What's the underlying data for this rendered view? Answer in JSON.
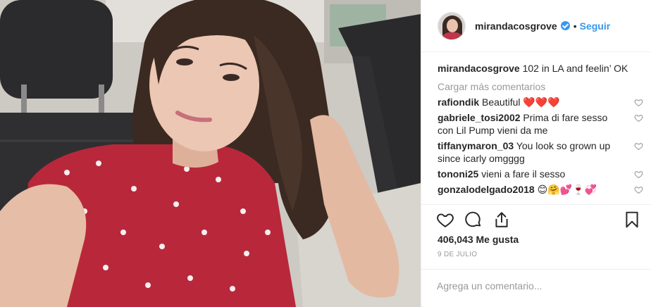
{
  "post": {
    "username": "mirandacosgrove",
    "follow_label": "Seguir",
    "separator": "•",
    "caption_user": "mirandacosgrove",
    "caption_text": "102 in LA and feelin’ OK",
    "load_more": "Cargar más comentarios",
    "comments": [
      {
        "user": "rafiondik",
        "text": "Beautiful ❤️❤️❤️"
      },
      {
        "user": "gabriele_tosi2002",
        "text": "Prima di fare sesso con Lil Pump vieni da me"
      },
      {
        "user": "tiffanymaron_03",
        "text": "You look so grown up since icarly omgggg"
      },
      {
        "user": "tononi25",
        "text": "vieni a fare il sesso"
      },
      {
        "user": "gonzalodelgado2018",
        "text": "😊🤗💕🍷💞"
      }
    ],
    "likes": "406,043 Me gusta",
    "date": "9 DE JULIO",
    "comment_placeholder": "Agrega un comentario..."
  },
  "icons": {
    "verified": "verified-badge-icon",
    "like": "heart-icon",
    "comment": "comment-bubble-icon",
    "share": "share-icon",
    "save": "bookmark-icon"
  },
  "colors": {
    "accent": "#3897f0",
    "muted": "#999999",
    "text": "#262626",
    "divider": "#efefef"
  }
}
